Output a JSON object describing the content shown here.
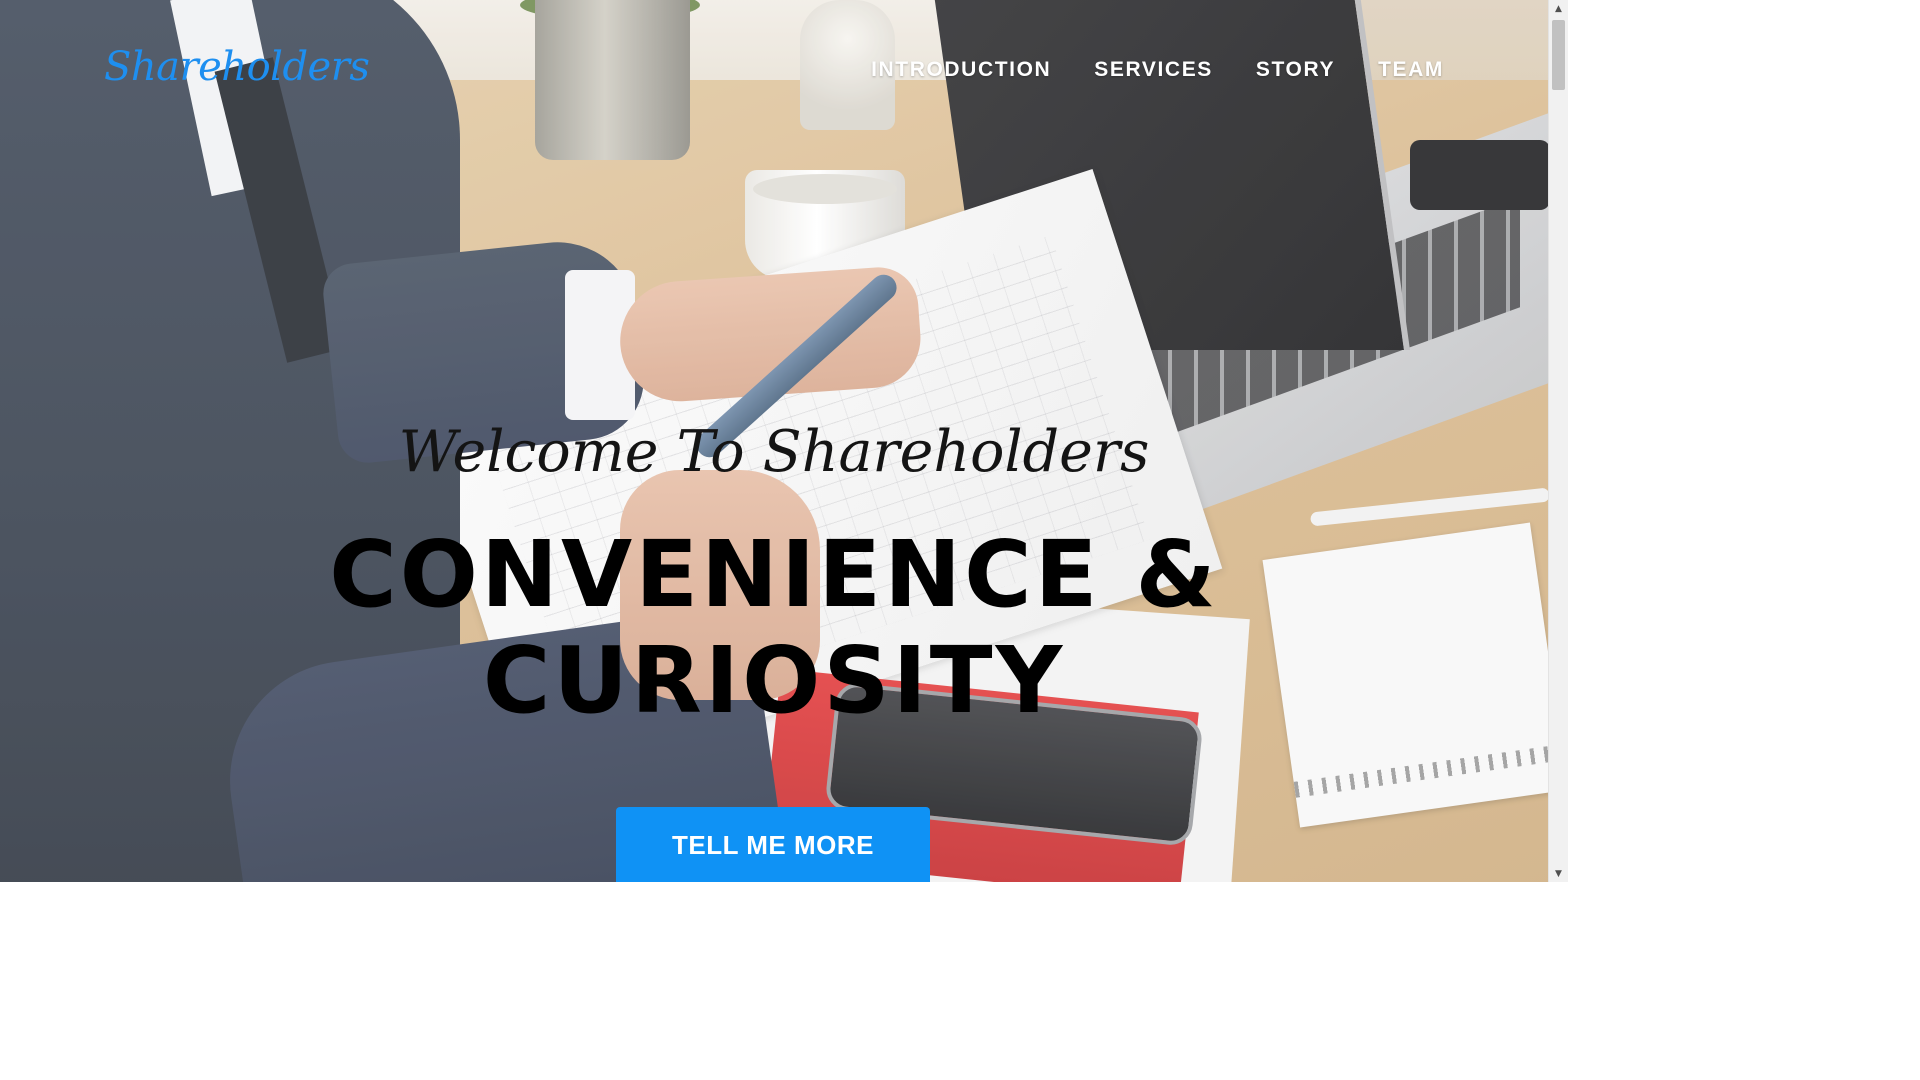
{
  "brand": {
    "name": "Shareholders",
    "color": "#1e8ff0"
  },
  "nav": {
    "items": [
      {
        "label": "INTRODUCTION"
      },
      {
        "label": "SERVICES"
      },
      {
        "label": "STORY"
      },
      {
        "label": "TEAM"
      }
    ]
  },
  "hero": {
    "lead_in": "Welcome To Shareholders",
    "heading_line1": "CONVENIENCE &",
    "heading_line2": "CURIOSITY",
    "cta_label": "TELL ME MORE",
    "cta_color": "#0f92f5"
  },
  "scrollbar": {
    "up_icon": "triangle-up-icon",
    "down_icon": "triangle-down-icon"
  }
}
